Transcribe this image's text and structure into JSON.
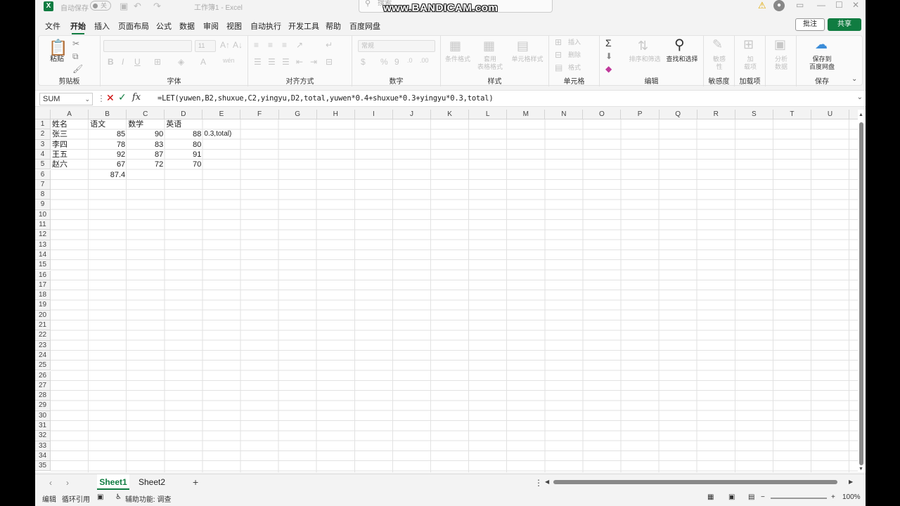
{
  "titlebar": {
    "autosave_label": "自动保存",
    "autosave_state": "关",
    "workbook_title": "工作簿1 - Excel",
    "search_placeholder": "搜索",
    "watermark": "www.BANDICAM.com"
  },
  "menu": {
    "tabs": [
      "文件",
      "开始",
      "插入",
      "页面布局",
      "公式",
      "数据",
      "审阅",
      "视图",
      "自动执行",
      "开发工具",
      "帮助",
      "百度网盘"
    ],
    "active_tab": "开始",
    "comments_label": "批注",
    "share_label": "共享"
  },
  "ribbon": {
    "clipboard": {
      "paste": "粘贴",
      "label": "剪贴板"
    },
    "font": {
      "font_size": "11",
      "label": "字体"
    },
    "alignment": {
      "label": "对齐方式"
    },
    "number": {
      "format": "常规",
      "label": "数字"
    },
    "styles": {
      "conditional": "条件格式",
      "table_1": "套用",
      "table_2": "表格格式",
      "cell_styles": "单元格样式",
      "label": "样式"
    },
    "cells": {
      "insert": "插入",
      "delete": "删除",
      "format": "格式",
      "label": "单元格"
    },
    "editing": {
      "sort_filter": "排序和筛选",
      "find_select": "查找和选择",
      "label": "编辑"
    },
    "sensitivity": {
      "top": "敏感",
      "bottom": "性",
      "label": "敏感度"
    },
    "addins": {
      "top": "加",
      "bottom": "载项",
      "label": "加载项"
    },
    "analyze": {
      "top": "分析",
      "bottom": "数据"
    },
    "save": {
      "top": "保存到",
      "bottom": "百度网盘",
      "label": "保存"
    }
  },
  "formula_bar": {
    "name_box": "SUM",
    "formula": "=LET(yuwen,B2,shuxue,C2,yingyu,D2,total,yuwen*0.4+shuxue*0.3+yingyu*0.3,total)"
  },
  "grid": {
    "columns": [
      "A",
      "B",
      "C",
      "D",
      "E",
      "F",
      "G",
      "H",
      "I",
      "J",
      "K",
      "L",
      "M",
      "N",
      "O",
      "P",
      "Q",
      "R",
      "S",
      "T",
      "U"
    ],
    "row_count": 35,
    "cells": [
      {
        "ref": "A1",
        "value": "姓名"
      },
      {
        "ref": "B1",
        "value": "语文"
      },
      {
        "ref": "C1",
        "value": "数学"
      },
      {
        "ref": "D1",
        "value": "英语"
      },
      {
        "ref": "A2",
        "value": "张三"
      },
      {
        "ref": "B2",
        "value": "85"
      },
      {
        "ref": "C2",
        "value": "90"
      },
      {
        "ref": "D2",
        "value": "88"
      },
      {
        "ref": "E2",
        "value": "0.3,total)"
      },
      {
        "ref": "A3",
        "value": "李四"
      },
      {
        "ref": "B3",
        "value": "78"
      },
      {
        "ref": "C3",
        "value": "83"
      },
      {
        "ref": "D3",
        "value": "80"
      },
      {
        "ref": "A4",
        "value": "王五"
      },
      {
        "ref": "B4",
        "value": "92"
      },
      {
        "ref": "C4",
        "value": "87"
      },
      {
        "ref": "D4",
        "value": "91"
      },
      {
        "ref": "A5",
        "value": "赵六"
      },
      {
        "ref": "B5",
        "value": "67"
      },
      {
        "ref": "C5",
        "value": "72"
      },
      {
        "ref": "D5",
        "value": "70"
      },
      {
        "ref": "B6",
        "value": "87.4"
      }
    ]
  },
  "sheets": {
    "tabs": [
      "Sheet1",
      "Sheet2"
    ],
    "active": "Sheet1"
  },
  "statusbar": {
    "mode": "编辑",
    "circular": "循环引用",
    "accessibility": "辅助功能: 调查",
    "zoom": "100%"
  },
  "colors": {
    "accent": "#107c41",
    "cancel": "#cc0000"
  }
}
